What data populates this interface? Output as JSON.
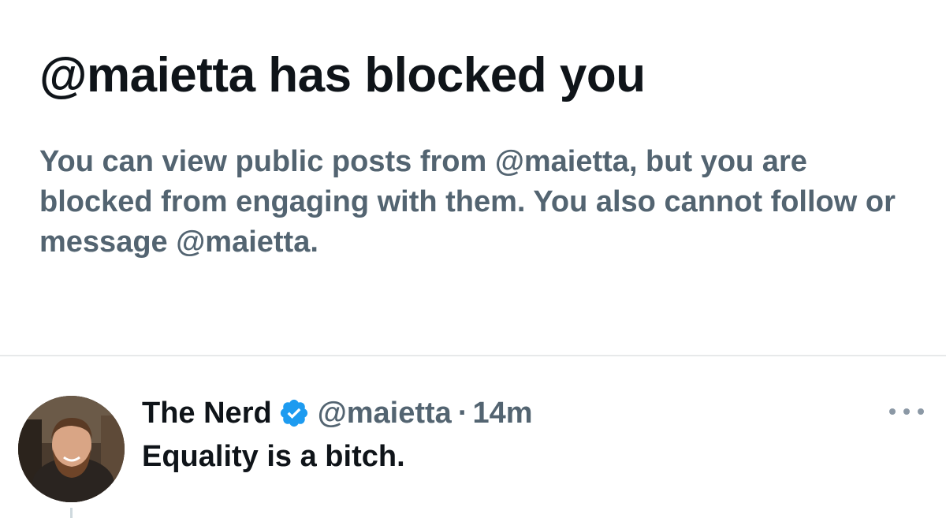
{
  "blocked": {
    "title": "@maietta has blocked you",
    "description": "You can view public posts from @maietta, but you are blocked from engaging with them. You also cannot follow or message @maietta."
  },
  "post": {
    "display_name": "The Nerd",
    "verified": true,
    "handle": "@maietta",
    "separator": "·",
    "timestamp": "14m",
    "text": "Equality is a bitch.",
    "avatar_icon": "profile-photo",
    "more_icon": "more-horizontal-icon"
  },
  "colors": {
    "primary_text": "#0f1419",
    "secondary_text": "#536471",
    "verified_blue": "#1d9bf0",
    "divider": "#e7e9ea"
  }
}
